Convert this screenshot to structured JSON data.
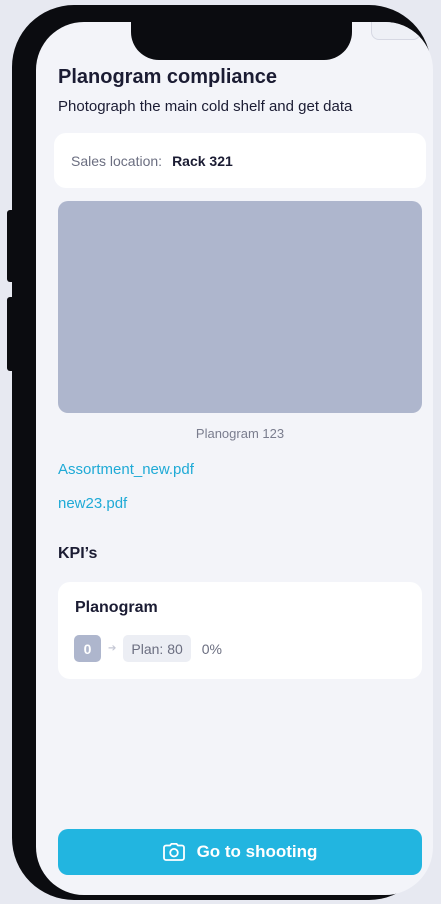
{
  "header": {
    "title": "Planogram compliance",
    "subtitle": "Photograph the main cold shelf and get data"
  },
  "location": {
    "label": "Sales location:",
    "value": "Rack 321"
  },
  "photo": {
    "caption": "Planogram 123"
  },
  "files": [
    {
      "name": "Assortment_new.pdf"
    },
    {
      "name": "new23.pdf"
    }
  ],
  "kpi": {
    "heading": "KPI’s",
    "items": [
      {
        "name": "Planogram",
        "fact": "0",
        "plan": "Plan: 80",
        "percent": "0%"
      }
    ]
  },
  "actions": {
    "shoot_label": "Go to shooting",
    "shoot_icon": "camera-icon"
  },
  "colors": {
    "accent": "#22b5e0",
    "link": "#1faad6",
    "placeholder": "#aeb6cd"
  }
}
